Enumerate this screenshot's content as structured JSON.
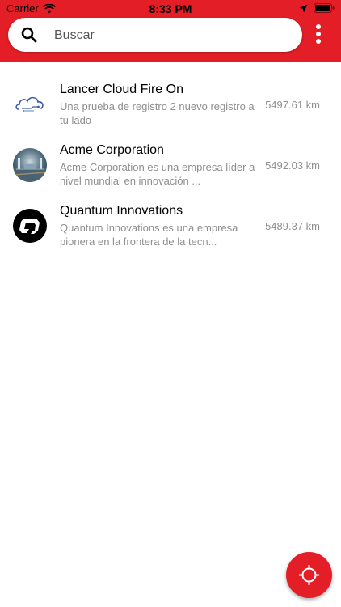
{
  "status_bar": {
    "carrier": "Carrier",
    "time": "8:33 PM"
  },
  "search": {
    "placeholder": "Buscar",
    "value": ""
  },
  "colors": {
    "accent": "#e41e26",
    "secondary_text": "#8e8e8e"
  },
  "items": [
    {
      "title": "Lancer Cloud Fire On",
      "description": "Una prueba de registro 2 nuevo registro a tu lado",
      "distance": "5497.61 km",
      "icon": "cloud-logo"
    },
    {
      "title": "Acme Corporation",
      "description": "Acme Corporation es una empresa líder a nivel mundial en innovación ...",
      "distance": "5492.03 km",
      "icon": "corporate-photo"
    },
    {
      "title": "Quantum Innovations",
      "description": "Quantum Innovations es una empresa pionera en la frontera de la tecn...",
      "distance": "5489.37 km",
      "icon": "q-logo"
    }
  ],
  "fab": {
    "icon": "locate-crosshair-icon"
  }
}
